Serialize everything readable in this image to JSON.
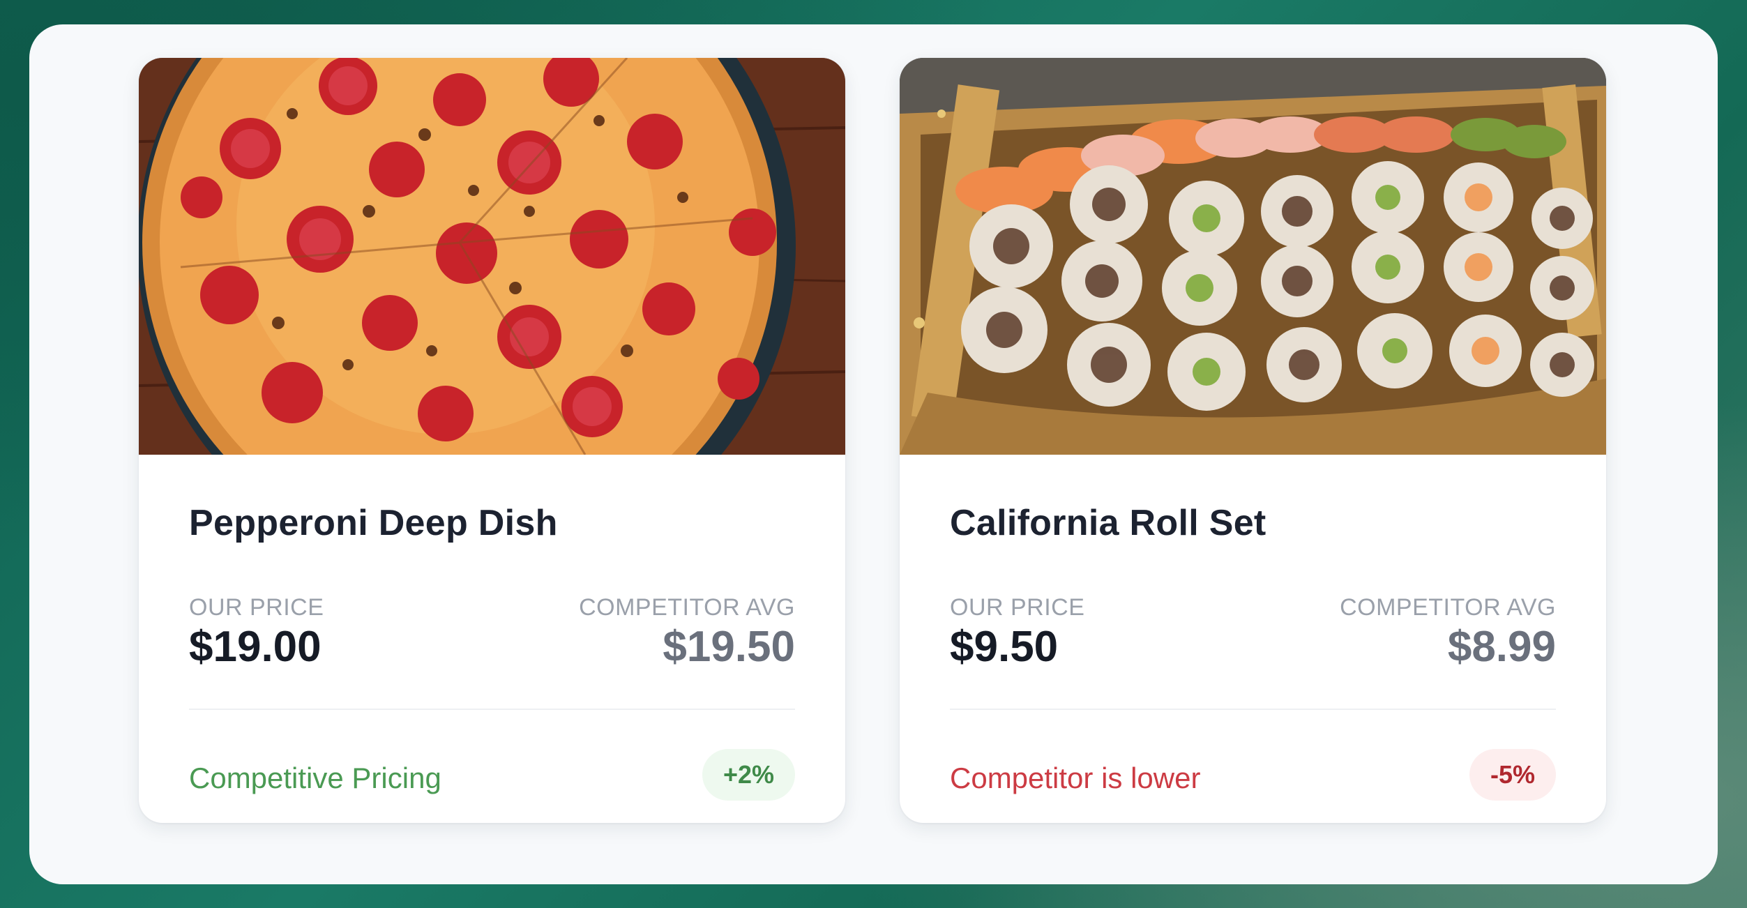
{
  "products": [
    {
      "name": "Pepperoni Deep Dish",
      "image_icon": "pizza-photo",
      "our_price_label": "OUR PRICE",
      "our_price": "$19.00",
      "competitor_label": "COMPETITOR AVG",
      "competitor_price": "$19.50",
      "status": "Competitive Pricing",
      "diff": "+2%",
      "status_color": "#4a9a53"
    },
    {
      "name": "California Roll Set",
      "image_icon": "sushi-boat-photo",
      "our_price_label": "OUR PRICE",
      "our_price": "$9.50",
      "competitor_label": "COMPETITOR AVG",
      "competitor_price": "$8.99",
      "status": "Competitor is lower",
      "diff": "-5%",
      "status_color": "#cc3b43"
    }
  ]
}
